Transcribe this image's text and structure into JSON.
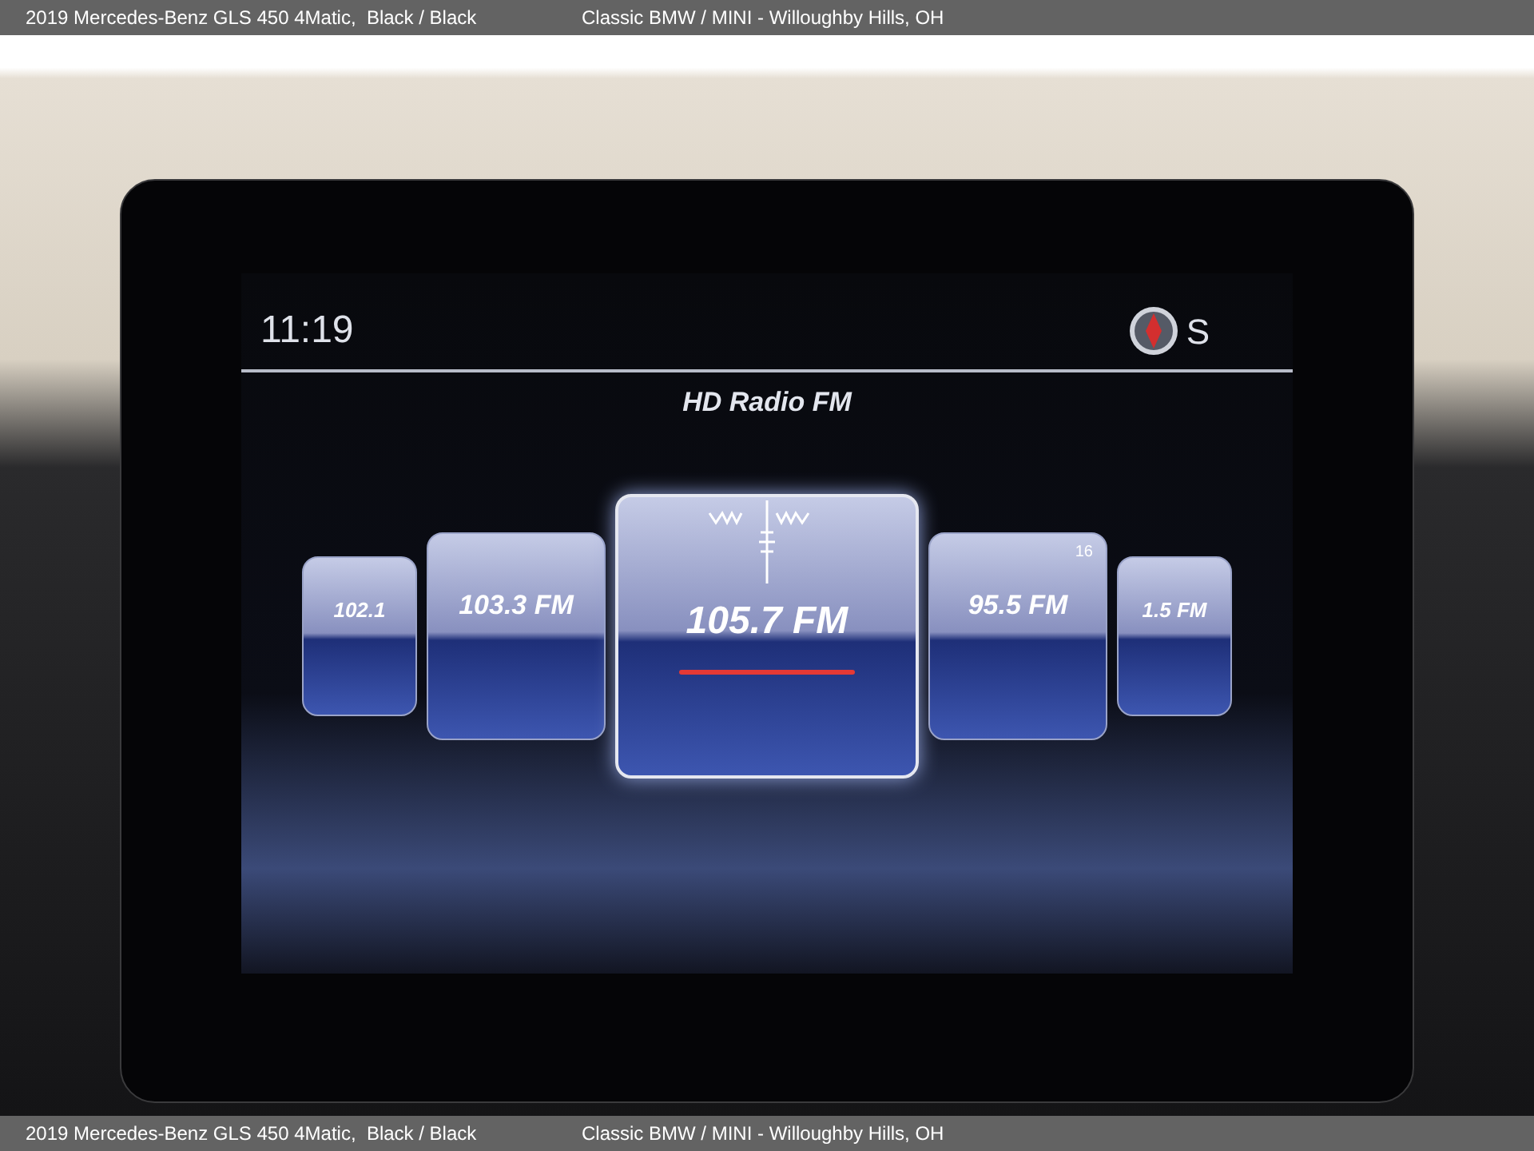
{
  "caption_bars": [
    {
      "vehicle": "2019 Mercedes-Benz GLS 450 4Matic,  Black / Black",
      "dealer": "Classic BMW / MINI - Willoughby Hills, OH"
    },
    {
      "vehicle": "2019 Mercedes-Benz GLS 450 4Matic,  Black / Black",
      "dealer": "Classic BMW / MINI - Willoughby Hills, OH"
    }
  ],
  "display": {
    "time": "11:19",
    "compass_heading": "S",
    "title": "HD Radio FM",
    "stations": [
      {
        "frequency": "102.1",
        "selected": false
      },
      {
        "frequency": "103.3 FM",
        "selected": false
      },
      {
        "frequency": "105.7 FM",
        "selected": true
      },
      {
        "frequency": "95.5 FM",
        "selected": false,
        "badge": "16"
      },
      {
        "frequency": "1.5 FM",
        "selected": false
      }
    ]
  }
}
